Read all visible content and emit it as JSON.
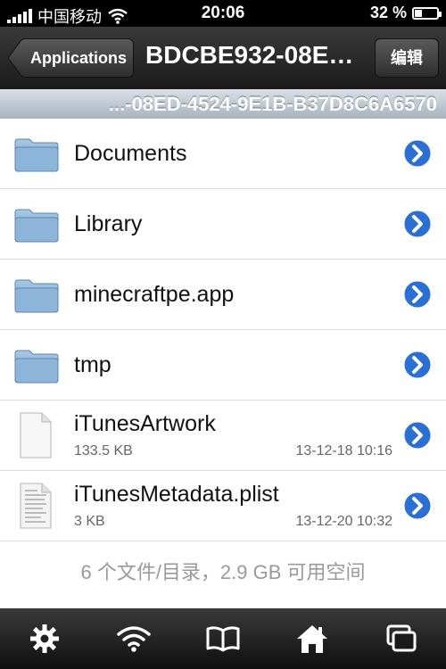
{
  "status_bar": {
    "carrier": "中国移动",
    "time": "20:06",
    "battery_percent": "32 %",
    "battery_level": 0.32
  },
  "nav": {
    "back_label": "Applications",
    "title": "BDCBE932-08ED-4524-9E1B-B37D8C6A6570",
    "edit_label": "编辑"
  },
  "path": "...-08ED-4524-9E1B-B37D8C6A6570",
  "items": [
    {
      "name": "Documents",
      "kind": "folder"
    },
    {
      "name": "Library",
      "kind": "folder"
    },
    {
      "name": "minecraftpe.app",
      "kind": "folder"
    },
    {
      "name": "tmp",
      "kind": "folder"
    },
    {
      "name": "iTunesArtwork",
      "kind": "file",
      "size": "133.5 KB",
      "date": "13-12-18 10:16"
    },
    {
      "name": "iTunesMetadata.plist",
      "kind": "text-file",
      "size": "3 KB",
      "date": "13-12-20 10:32"
    }
  ],
  "footer": "6 个文件/目录，2.9 GB 可用空间",
  "tabs": [
    "gear-icon",
    "wifi-icon",
    "book-icon",
    "home-icon",
    "windows-icon"
  ],
  "colors": {
    "accent_blue": "#2a6fd6",
    "folder": "#7fa9cf"
  }
}
